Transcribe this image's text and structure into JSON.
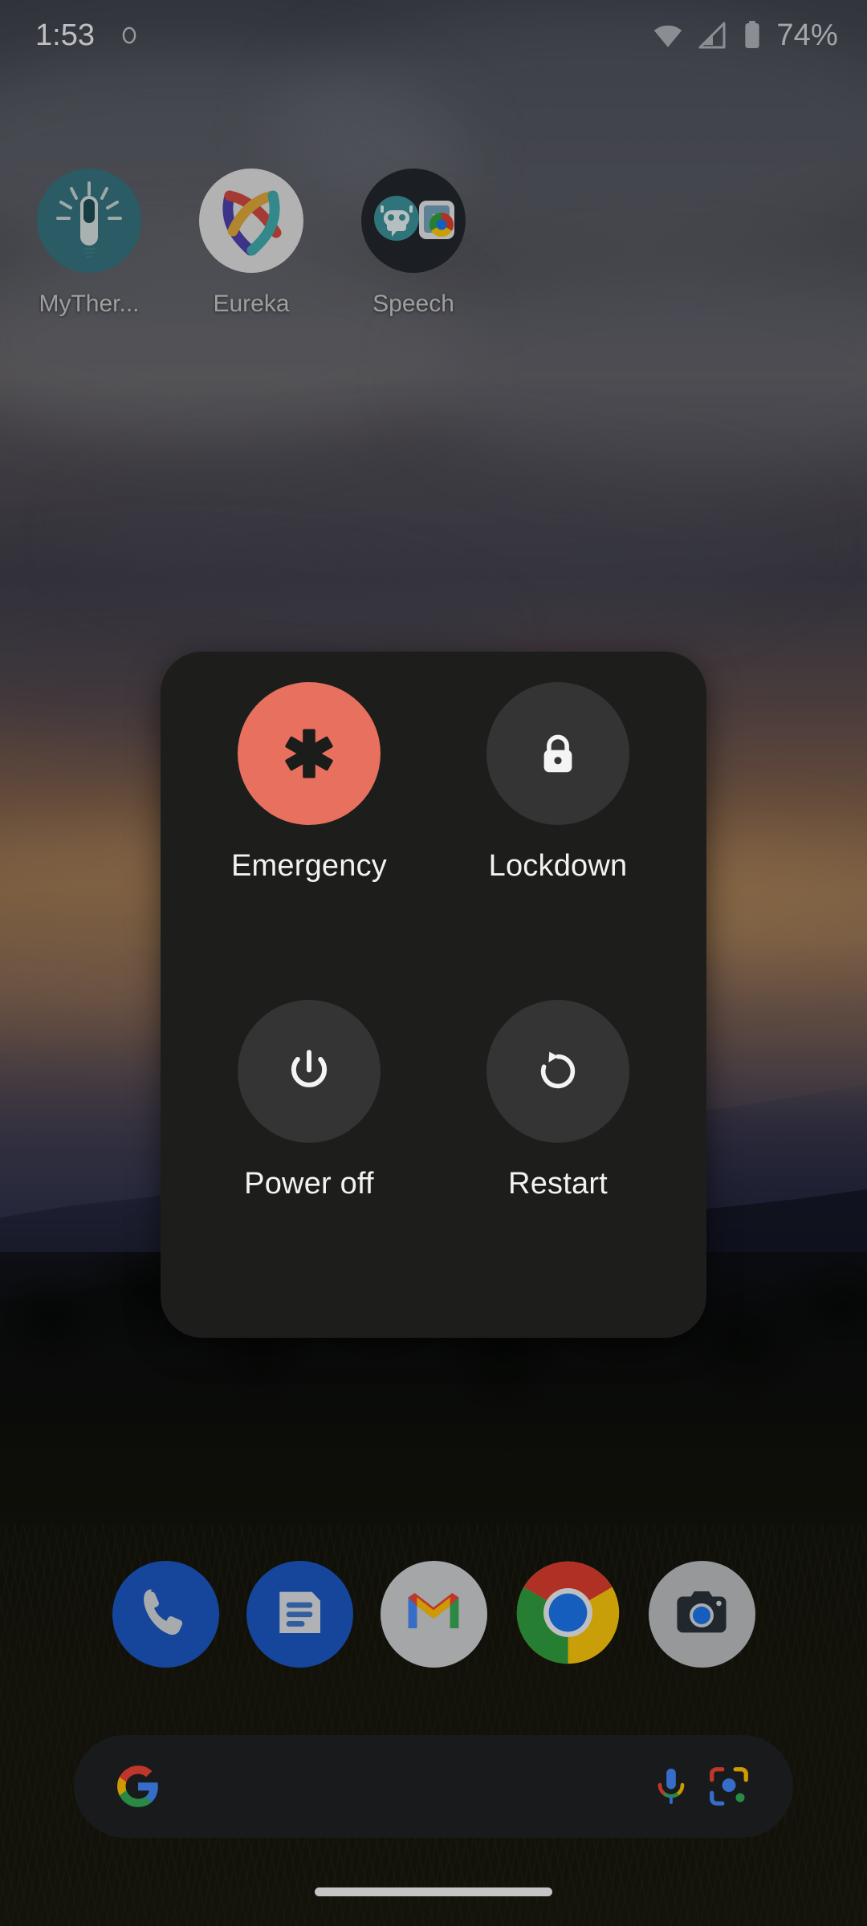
{
  "status_bar": {
    "time": "1:53",
    "alarm_indicator": "(o)",
    "battery_percent": "74%",
    "icons": [
      "alarm-icon",
      "wifi-icon",
      "cellular-signal-icon",
      "battery-icon"
    ]
  },
  "home_screen": {
    "apps": [
      {
        "label": "MyTher...",
        "icon": "mythermometer-icon"
      },
      {
        "label": "Eureka",
        "icon": "eureka-icon"
      },
      {
        "label": "Speech",
        "icon": "speech-folder-icon"
      }
    ]
  },
  "power_dialog": {
    "accent_color": "#e8705e",
    "surface_color": "#1d1e1b",
    "button_color": "#343434",
    "items": [
      {
        "label": "Emergency",
        "icon": "star-of-life-icon",
        "highlighted": true
      },
      {
        "label": "Lockdown",
        "icon": "lock-icon",
        "highlighted": false
      },
      {
        "label": "Power off",
        "icon": "power-icon",
        "highlighted": false
      },
      {
        "label": "Restart",
        "icon": "restart-icon",
        "highlighted": false
      }
    ]
  },
  "dock": {
    "apps": [
      {
        "label": "Phone",
        "icon": "phone-icon"
      },
      {
        "label": "Messages",
        "icon": "messages-icon"
      },
      {
        "label": "Gmail",
        "icon": "gmail-icon"
      },
      {
        "label": "Chrome",
        "icon": "chrome-icon"
      },
      {
        "label": "Camera",
        "icon": "camera-icon"
      }
    ]
  },
  "search": {
    "value": "",
    "placeholder": "",
    "logo": "google-g-icon",
    "voice_icon": "microphone-icon",
    "lens_icon": "google-lens-icon"
  },
  "navigation": {
    "mode": "gesture",
    "handle": "home-gesture-pill"
  }
}
